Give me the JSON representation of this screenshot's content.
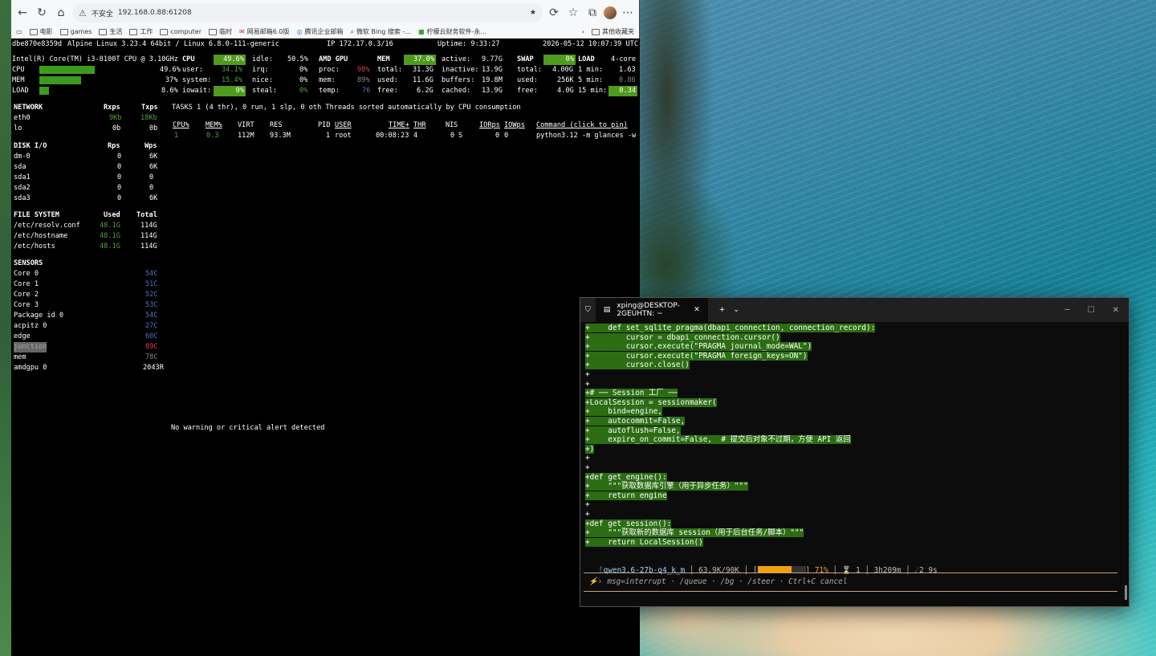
{
  "browser": {
    "security": "不安全",
    "url": "192.168.0.88:61208",
    "bookmarks": [
      "电影",
      "games",
      "生活",
      "工作",
      "computer",
      "临时",
      "网易邮箱6.0版",
      "腾讯企业邮箱",
      "微软 Bing 搜索 -...",
      "柠檬云财务软件-永..."
    ],
    "bookmarks_other": "其他收藏夹"
  },
  "glances": {
    "header": {
      "host": "dbe870e8359d",
      "os": "Alpine Linux 3.23.4 64bit / Linux 6.8.0-111-generic",
      "ip": "IP 172.17.0.3/16",
      "uptime": "Uptime: 9:33:27",
      "datetime": "2026-05-12 10:07:39 UTC"
    },
    "cpu_model": "Intel(R) Core(TM) i3-8100T CPU @ 3.10GHz",
    "quicklook": [
      {
        "label": "CPU",
        "value": "49.6%",
        "fill": 0.496
      },
      {
        "label": "MEM",
        "value": "37%",
        "fill": 0.37
      },
      {
        "label": "LOAD",
        "value": "8.6%",
        "fill": 0.086
      }
    ],
    "cpu": {
      "title": "CPU",
      "total": "49.6%",
      "user": "34.1%",
      "system": "15.4%",
      "iowait": "0%",
      "idle": "50.5%",
      "irq": "0%",
      "nice": "0%",
      "steal": "0%"
    },
    "gpu": {
      "title": "AMD GPU",
      "proc": "98%",
      "mem": "89%",
      "temp": "76"
    },
    "mem": {
      "title": "MEM",
      "percent": "37.0%",
      "total": "31.3G",
      "used": "11.6G",
      "free": "6.2G",
      "active": "9.77G",
      "inactive": "13.9G",
      "buffers": "19.8M",
      "cached": "13.9G"
    },
    "swap": {
      "title": "SWAP",
      "percent": "0%",
      "total": "4.00G",
      "used": "256K",
      "free": "4.0G"
    },
    "load": {
      "title": "LOAD",
      "cores": "4-core",
      "m1": "1.63",
      "m5": "0.86",
      "m15": "0.34"
    },
    "network": {
      "title": "NETWORK",
      "rx": "Rxps",
      "tx": "Txps",
      "rows": [
        {
          "name": "eth0",
          "rx": "9Kb",
          "tx": "18Kb"
        },
        {
          "name": "lo",
          "rx": "0b",
          "tx": "0b"
        }
      ]
    },
    "disk": {
      "title": "DISK I/O",
      "r": "Rps",
      "w": "Wps",
      "rows": [
        {
          "name": "dm-0",
          "r": "0",
          "w": "6K"
        },
        {
          "name": "sda",
          "r": "0",
          "w": "6K"
        },
        {
          "name": "sda1",
          "r": "0",
          "w": "0"
        },
        {
          "name": "sda2",
          "r": "0",
          "w": "0"
        },
        {
          "name": "sda3",
          "r": "0",
          "w": "6K"
        }
      ]
    },
    "fs": {
      "title": "FILE SYSTEM",
      "used": "Used",
      "total": "Total",
      "rows": [
        {
          "name": "/etc/resolv.conf",
          "used": "48.1G",
          "total": "114G"
        },
        {
          "name": "/etc/hostname",
          "used": "48.1G",
          "total": "114G"
        },
        {
          "name": "/etc/hosts",
          "used": "48.1G",
          "total": "114G"
        }
      ]
    },
    "sensors": {
      "title": "SENSORS",
      "rows": [
        {
          "name": "Core 0",
          "val": "54C"
        },
        {
          "name": "Core 1",
          "val": "51C"
        },
        {
          "name": "Core 2",
          "val": "52C"
        },
        {
          "name": "Core 3",
          "val": "53C"
        },
        {
          "name": "Package id 0",
          "val": "54C"
        },
        {
          "name": "acpitz 0",
          "val": "27C"
        },
        {
          "name": "edge",
          "val": "60C"
        },
        {
          "name": "junction",
          "val": "89C"
        },
        {
          "name": "mem",
          "val": "78C"
        },
        {
          "name": "amdgpu 0",
          "val": "2043R"
        }
      ]
    },
    "tasks": "TASKS 1 (4 thr), 0 run, 1 slp, 0 oth Threads sorted automatically by CPU consumption",
    "proc_headers": [
      "CPU%",
      "MEM%",
      "VIRT",
      "RES",
      "PID",
      "USER",
      "TIME+",
      "THR",
      "NI",
      "S",
      "IORps",
      "IOWps",
      "Command (click to pin)"
    ],
    "proc": {
      "cpu": "1",
      "mem": "0.3",
      "virt": "112M",
      "res": "93.3M",
      "pid": "1",
      "user": "root",
      "time": "00:08:23",
      "thr": "4",
      "ni": "0",
      "s": "S",
      "ior": "0",
      "iow": "0",
      "cmd": "python3.12 -m glances -w"
    },
    "alert": "No warning or critical alert detected"
  },
  "terminal": {
    "tab_title": "xping@DESKTOP-2GEUHTN: ~",
    "lines": [
      "+    def set_sqlite_pragma(dbapi_connection, connection_record):",
      "+        cursor = dbapi_connection.cursor()",
      "+        cursor.execute(\"PRAGMA journal_mode=WAL\")",
      "+        cursor.execute(\"PRAGMA foreign_keys=ON\")",
      "+        cursor.close()",
      "+",
      "+",
      "+# ── Session 工厂 ──",
      "+LocalSession = sessionmaker(",
      "+    bind=engine,",
      "+    autocommit=False,",
      "+    autoflush=False,",
      "+    expire_on_commit=False,  # 提交后对象不过期，方便 API 返回",
      "+)",
      "+",
      "+",
      "+def get_engine():",
      "+    \"\"\"获取数据库引擎（用于异步任务）\"\"\"",
      "+    return engine",
      "+",
      "+",
      "+def get_session():",
      "+    \"\"\"获取新的数据库 session（用于后台任务/脚本）\"\"\"",
      "+    return LocalSession()"
    ],
    "status": {
      "model": "qwen3.6-27b-q4_k_m",
      "tokens": "63.9K/90K",
      "pct": "71%",
      "pct_fill": 0.71,
      "tasks": "1",
      "time": "3h209m",
      "msgs": "2 9s"
    },
    "prompt": "msg=interrupt · /queue · /bg · /steer · Ctrl+C cancel"
  }
}
